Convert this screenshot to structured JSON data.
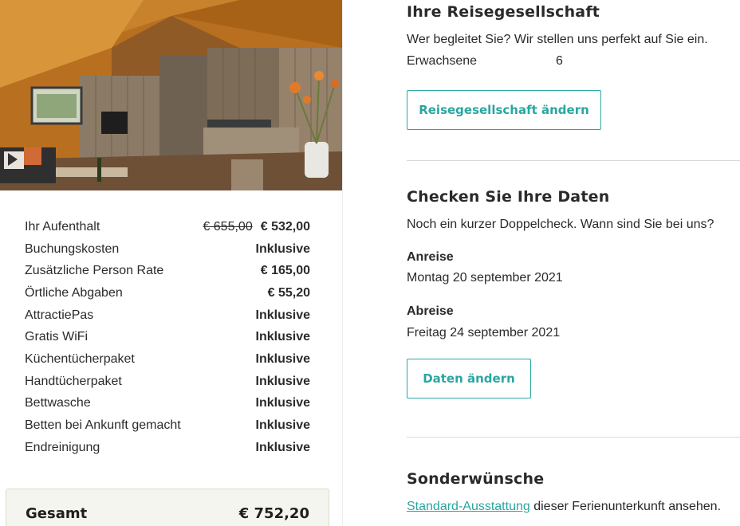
{
  "stay": {
    "price_rows": [
      {
        "label": "Ihr Aufenthalt",
        "old_value": "€ 655,00",
        "value": "€ 532,00"
      },
      {
        "label": "Buchungskosten",
        "value": "Inklusive"
      },
      {
        "label": "Zusätzliche Person Rate",
        "value": "€ 165,00"
      },
      {
        "label": "Örtliche Abgaben",
        "value": "€ 55,20"
      },
      {
        "label": "AttractiePas",
        "value": "Inklusive"
      },
      {
        "label": "Gratis WiFi",
        "value": "Inklusive"
      },
      {
        "label": "Küchentücherpaket",
        "value": "Inklusive"
      },
      {
        "label": "Handtücherpaket",
        "value": "Inklusive"
      },
      {
        "label": "Bettwasche",
        "value": "Inklusive"
      },
      {
        "label": "Betten bei Ankunft gemacht",
        "value": "Inklusive"
      },
      {
        "label": "Endreinigung",
        "value": "Inklusive"
      }
    ],
    "total_label": "Gesamt",
    "total_value": "€ 752,20"
  },
  "party": {
    "title": "Ihre Reisegesellschaft",
    "subtitle": "Wer begleitet Sie? Wir stellen uns perfekt auf Sie ein.",
    "adults_label": "Erwachsene",
    "adults_value": "6",
    "button_label": "Reisegesellschaft ändern"
  },
  "dates": {
    "title": "Checken Sie Ihre Daten",
    "subtitle": "Noch ein kurzer Doppelcheck. Wann sind Sie bei uns?",
    "arrival_label": "Anreise",
    "arrival_value": "Montag 20 september 2021",
    "departure_label": "Abreise",
    "departure_value": "Freitag 24 september 2021",
    "button_label": "Daten ändern"
  },
  "wishes": {
    "title": "Sonderwünsche",
    "link_text": "Standard-Ausstattung",
    "link_suffix": " dieser Ferienunterkunft ansehen."
  },
  "colors": {
    "accent": "#2aa6a1",
    "total_bg": "#f4f5ee"
  }
}
